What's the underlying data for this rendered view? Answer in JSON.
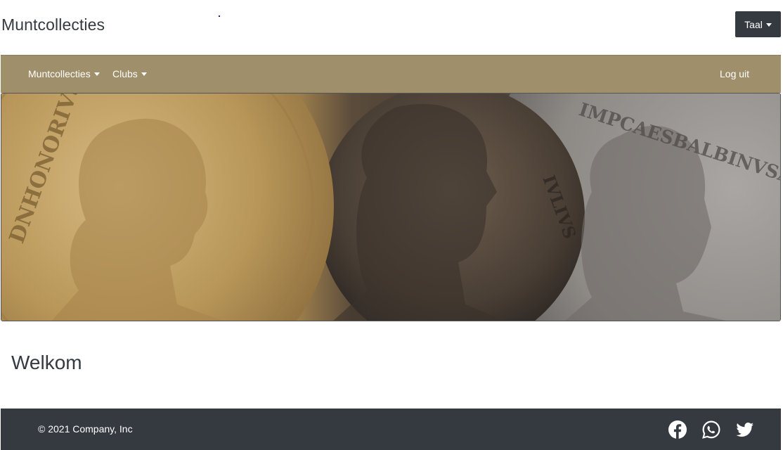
{
  "header": {
    "site_title": "Muntcollecties",
    "language_label": "Taal"
  },
  "nav": {
    "items": [
      {
        "label": "Muntcollecties"
      },
      {
        "label": "Clubs"
      }
    ],
    "logout_label": "Log uit"
  },
  "banner": {
    "coin_texts": {
      "gold": "DNHONORIVSPFAVG",
      "bronze": "IVLIVS",
      "silver": "IMPCAESBALBINVSAVG"
    },
    "colors": {
      "gold": "#b99a63",
      "bronze": "#4a3f35",
      "silver": "#8f8b88"
    }
  },
  "main": {
    "heading": "Welkom"
  },
  "footer": {
    "copyright": "© 2021 Company, Inc",
    "social": [
      {
        "icon": "facebook-icon"
      },
      {
        "icon": "whatsapp-icon"
      },
      {
        "icon": "twitter-icon"
      }
    ]
  },
  "colors": {
    "navbar_bg": "#a08f6b",
    "dark": "#343a40",
    "white": "#ffffff"
  }
}
